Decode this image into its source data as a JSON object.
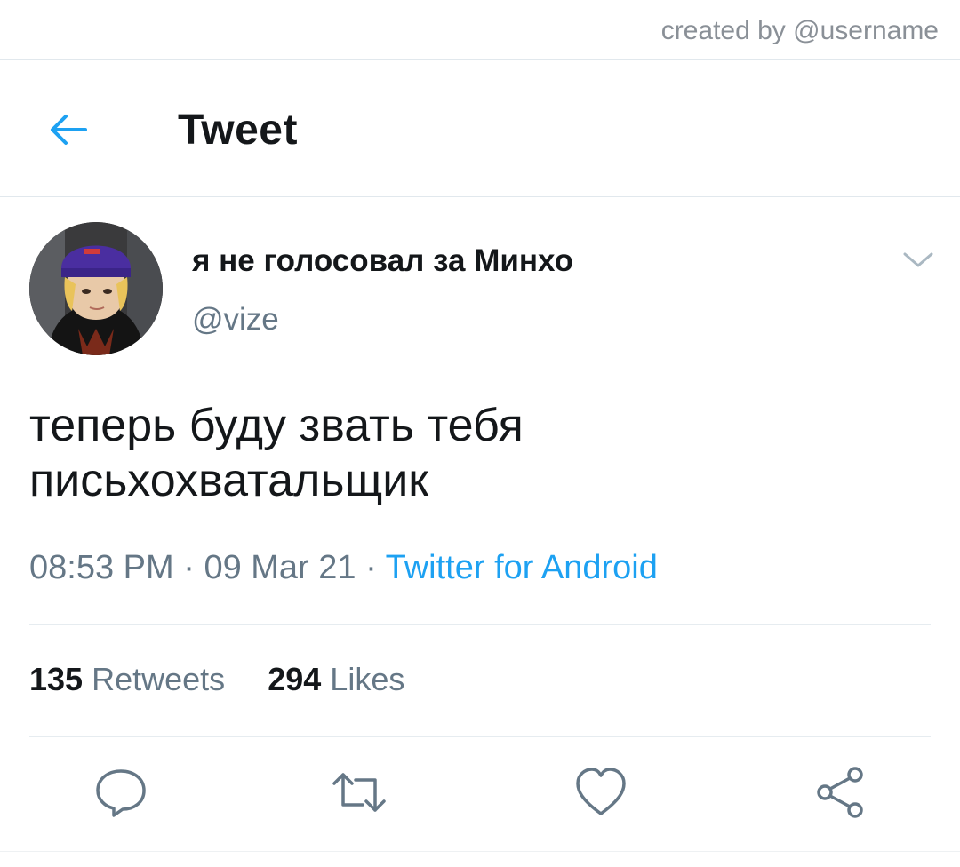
{
  "watermark": "created by @username",
  "header": {
    "title": "Tweet",
    "back_icon": "arrow-left-icon"
  },
  "author": {
    "display_name": "я не голосовал за Минхо",
    "handle": "@vize"
  },
  "tweet": {
    "line1": "теперь буду звать тебя",
    "line2": "письхохватальщик",
    "time": "08:53 PM",
    "separator": "·",
    "date": "09 Mar 21",
    "source": "Twitter for Android"
  },
  "stats": {
    "retweets_count": "135",
    "retweets_label": "Retweets",
    "likes_count": "294",
    "likes_label": "Likes"
  },
  "actions": [
    "reply-icon",
    "retweet-icon",
    "like-icon",
    "share-icon"
  ],
  "colors": {
    "accent": "#1da1f2",
    "secondary_text": "#657786",
    "primary_text": "#14171a",
    "divider": "#e6ecf0"
  }
}
